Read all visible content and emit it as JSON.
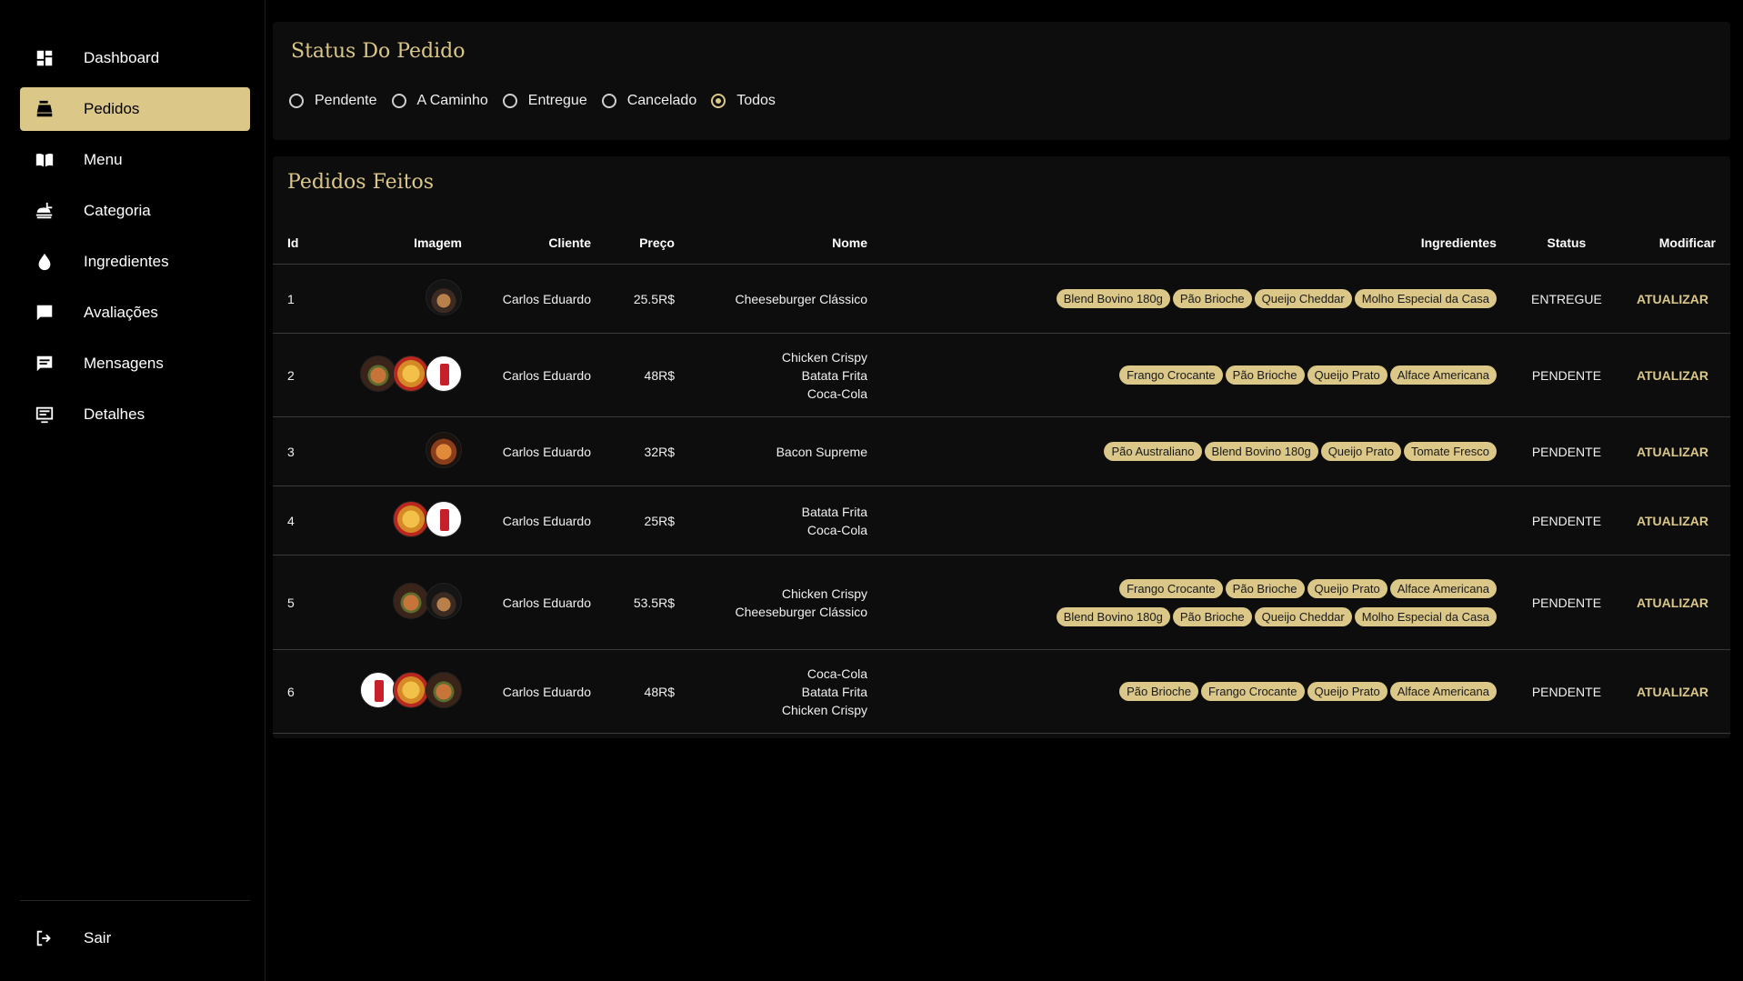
{
  "sidebar": {
    "items": [
      {
        "label": "Dashboard",
        "icon": "dashboard-icon",
        "active": false
      },
      {
        "label": "Pedidos",
        "icon": "register-icon",
        "active": true
      },
      {
        "label": "Menu",
        "icon": "book-icon",
        "active": false
      },
      {
        "label": "Categoria",
        "icon": "food-tray-icon",
        "active": false
      },
      {
        "label": "Ingredientes",
        "icon": "drop-icon",
        "active": false
      },
      {
        "label": "Avaliações",
        "icon": "rate-review-icon",
        "active": false
      },
      {
        "label": "Mensagens",
        "icon": "message-icon",
        "active": false
      },
      {
        "label": "Detalhes",
        "icon": "details-icon",
        "active": false
      }
    ],
    "logout": {
      "label": "Sair",
      "icon": "logout-icon"
    }
  },
  "status_filter": {
    "title": "Status Do Pedido",
    "options": [
      "Pendente",
      "A Caminho",
      "Entregue",
      "Cancelado",
      "Todos"
    ],
    "selected": "Todos"
  },
  "orders": {
    "title": "Pedidos Feitos",
    "headers": {
      "id": "Id",
      "imagem": "Imagem",
      "cliente": "Cliente",
      "preco": "Preço",
      "nome": "Nome",
      "ingredientes": "Ingredientes",
      "status": "Status",
      "modificar": "Modificar"
    },
    "action_label": "ATUALIZAR",
    "rows": [
      {
        "id": "1",
        "images": [
          "burger-dark"
        ],
        "cliente": "Carlos Eduardo",
        "preco": "25.5R$",
        "nomes": [
          "Cheeseburger Clássico"
        ],
        "ingredientes": [
          [
            "Blend Bovino 180g",
            "Pão Brioche",
            "Queijo Cheddar",
            "Molho Especial da Casa"
          ]
        ],
        "status": "ENTREGUE"
      },
      {
        "id": "2",
        "images": [
          "burger",
          "fries",
          "cola"
        ],
        "cliente": "Carlos Eduardo",
        "preco": "48R$",
        "nomes": [
          "Chicken Crispy",
          "Batata Frita",
          "Coca-Cola"
        ],
        "ingredientes": [
          [
            "Frango Crocante",
            "Pão Brioche",
            "Queijo Prato",
            "Alface Americana"
          ]
        ],
        "status": "PENDENTE"
      },
      {
        "id": "3",
        "images": [
          "bacon"
        ],
        "cliente": "Carlos Eduardo",
        "preco": "32R$",
        "nomes": [
          "Bacon Supreme"
        ],
        "ingredientes": [
          [
            "Pão Australiano",
            "Blend Bovino 180g",
            "Queijo Prato",
            "Tomate Fresco"
          ]
        ],
        "status": "PENDENTE"
      },
      {
        "id": "4",
        "images": [
          "fries",
          "cola"
        ],
        "cliente": "Carlos Eduardo",
        "preco": "25R$",
        "nomes": [
          "Batata Frita",
          "Coca-Cola"
        ],
        "ingredientes": [],
        "status": "PENDENTE"
      },
      {
        "id": "5",
        "images": [
          "burger",
          "burger-dark"
        ],
        "cliente": "Carlos Eduardo",
        "preco": "53.5R$",
        "nomes": [
          "Chicken Crispy",
          "Cheeseburger Clássico"
        ],
        "ingredientes": [
          [
            "Frango Crocante",
            "Pão Brioche",
            "Queijo Prato",
            "Alface Americana"
          ],
          [
            "Blend Bovino 180g",
            "Pão Brioche",
            "Queijo Cheddar",
            "Molho Especial da Casa"
          ]
        ],
        "status": "PENDENTE"
      },
      {
        "id": "6",
        "images": [
          "cola",
          "fries",
          "burger"
        ],
        "cliente": "Carlos Eduardo",
        "preco": "48R$",
        "nomes": [
          "Coca-Cola",
          "Batata Frita",
          "Chicken Crispy"
        ],
        "ingredientes": [
          [
            "Pão Brioche",
            "Frango Crocante",
            "Queijo Prato",
            "Alface Americana"
          ]
        ],
        "status": "PENDENTE"
      }
    ]
  },
  "colors": {
    "accent": "#dbc788",
    "background": "#000000",
    "card": "#0d0d0d"
  }
}
